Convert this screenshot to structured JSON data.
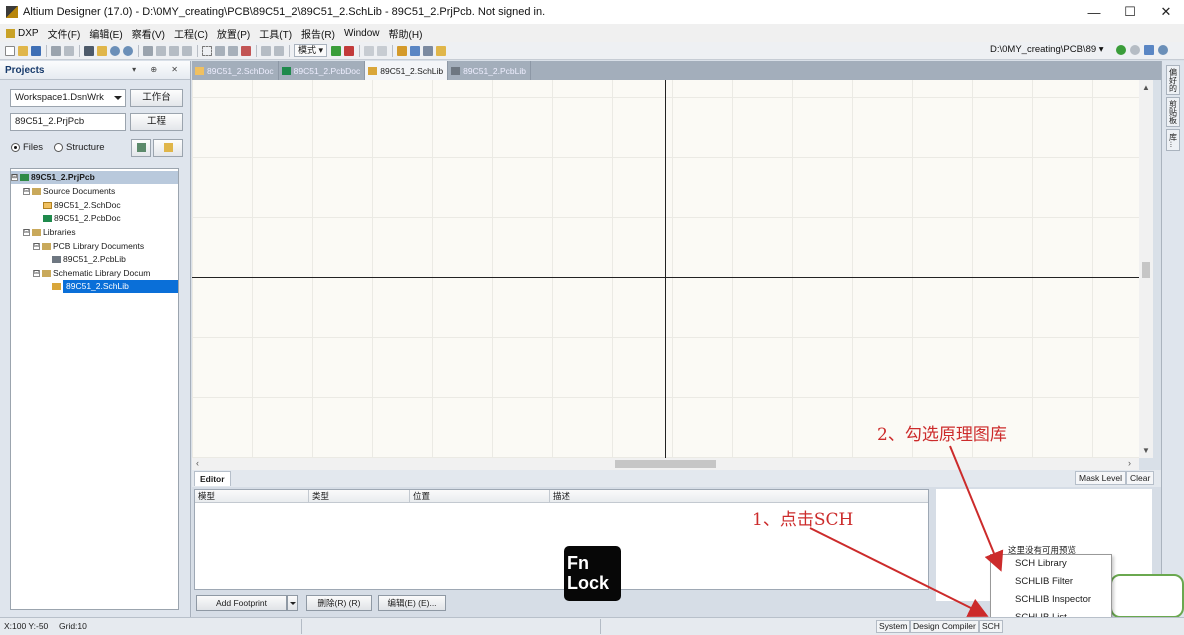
{
  "window": {
    "title": "Altium Designer (17.0) - D:\\0MY_creating\\PCB\\89C51_2\\89C51_2.SchLib - 89C51_2.PrjPcb. Not signed in.",
    "minimize": "—",
    "maximize": "☐",
    "close": "✕"
  },
  "menu": {
    "items": [
      "DXP",
      "文件(F)",
      "编辑(E)",
      "察看(V)",
      "工程(C)",
      "放置(P)",
      "工具(T)",
      "报告(R)",
      "Window",
      "帮助(H)"
    ]
  },
  "toolbar": {
    "mode_label": "模式 ▾",
    "path": "D:\\0MY_creating\\PCB\\89 ▾"
  },
  "projects_panel": {
    "title": "Projects",
    "header_controls": "▾ ⊕ ✕",
    "workspace_value": "Workspace1.DsnWrk",
    "workspace_button": "工作台",
    "project_value": "89C51_2.PrjPcb",
    "project_button": "工程",
    "radio_files": "Files",
    "radio_structure": "Structure",
    "tree": [
      {
        "label": "89C51_2.PrjPcb",
        "level": 0,
        "expander": "⊟"
      },
      {
        "label": "Source Documents",
        "level": 1,
        "expander": "⊟"
      },
      {
        "label": "89C51_2.SchDoc",
        "level": 2,
        "expander": ""
      },
      {
        "label": "89C51_2.PcbDoc",
        "level": 2,
        "expander": ""
      },
      {
        "label": "Libraries",
        "level": 1,
        "expander": "⊟"
      },
      {
        "label": "PCB Library Documents",
        "level": 2,
        "expander": "⊟"
      },
      {
        "label": "89C51_2.PcbLib",
        "level": 3,
        "expander": ""
      },
      {
        "label": "Schematic Library Docum",
        "level": 2,
        "expander": "⊟"
      },
      {
        "label": "89C51_2.SchLib",
        "level": 3,
        "expander": ""
      }
    ]
  },
  "doc_tabs": [
    "89C51_2.SchDoc",
    "89C51_2.PcbDoc",
    "89C51_2.SchLib",
    "89C51_2.PcbLib"
  ],
  "right_strip": [
    "偏好的",
    "剪贴板",
    "库..."
  ],
  "editor": {
    "tab": "Editor",
    "mask_level": "Mask Level",
    "clear": "Clear",
    "columns": [
      "模型",
      "类型",
      "位置",
      "描述"
    ],
    "no_preview": "这里没有可用预览",
    "add_footprint": "Add Footprint",
    "delete_button": "删除(R) (R)",
    "edit_button": "编辑(E) (E)..."
  },
  "fn_lock": {
    "line1": "Fn",
    "line2": "Lock"
  },
  "popup_menu": [
    "SCH Library",
    "SCHLIB Filter",
    "SCHLIB Inspector",
    "SCHLIB List"
  ],
  "statusbar": {
    "coords": "X:100 Y:-50",
    "grid": "Grid:10",
    "system": "System",
    "design_compiler": "Design Compiler",
    "sch": "SCH"
  },
  "annotations": {
    "step1": "1、点击SCH",
    "step2": "2、勾选原理图库"
  },
  "colors": {
    "accent_red": "#cc2b2b",
    "selection_blue": "#0a6fd8",
    "canvas": "#fbfaf5"
  }
}
